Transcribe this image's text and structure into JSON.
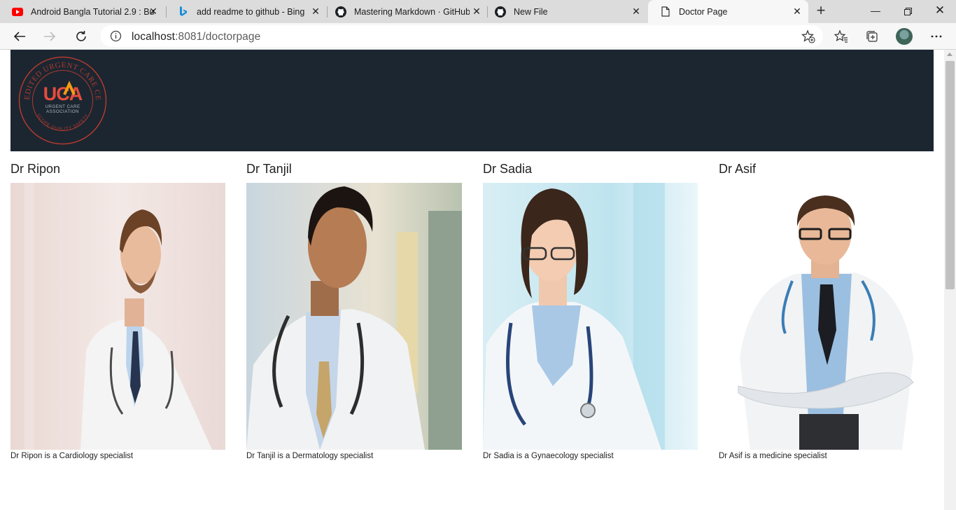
{
  "browser": {
    "tabs": [
      {
        "title": "Android Bangla Tutorial 2.9 : Bu",
        "icon": "youtube-icon"
      },
      {
        "title": "add readme to github - Bing",
        "icon": "bing-icon"
      },
      {
        "title": "Mastering Markdown · GitHub",
        "icon": "github-icon"
      },
      {
        "title": "New File",
        "icon": "github-icon"
      },
      {
        "title": "Doctor Page",
        "icon": "page-icon",
        "active": true
      }
    ],
    "address": {
      "host": "localhost",
      "rest": ":8081/doctorpage"
    }
  },
  "logo": {
    "letters": "UCA",
    "line1": "URGENT CARE",
    "line2": "ASSOCIATION",
    "ring_text": "ACCREDITED URGENT CARE CENTER",
    "ring_bottom": "SCOPE QUALITY SAFETY"
  },
  "doctors": [
    {
      "name": "Dr Ripon",
      "caption": "Dr Ripon is a Cardiology specialist"
    },
    {
      "name": "Dr Tanjil",
      "caption": "Dr Tanjil is a Dermatology specialist"
    },
    {
      "name": "Dr Sadia",
      "caption": "Dr Sadia is a Gynaecology specialist"
    },
    {
      "name": "Dr Asif",
      "caption": "Dr Asif is a medicine specialist"
    }
  ],
  "colors": {
    "header_bg": "#1b2631",
    "logo_red": "#c0392b",
    "logo_orange": "#f39c12"
  }
}
